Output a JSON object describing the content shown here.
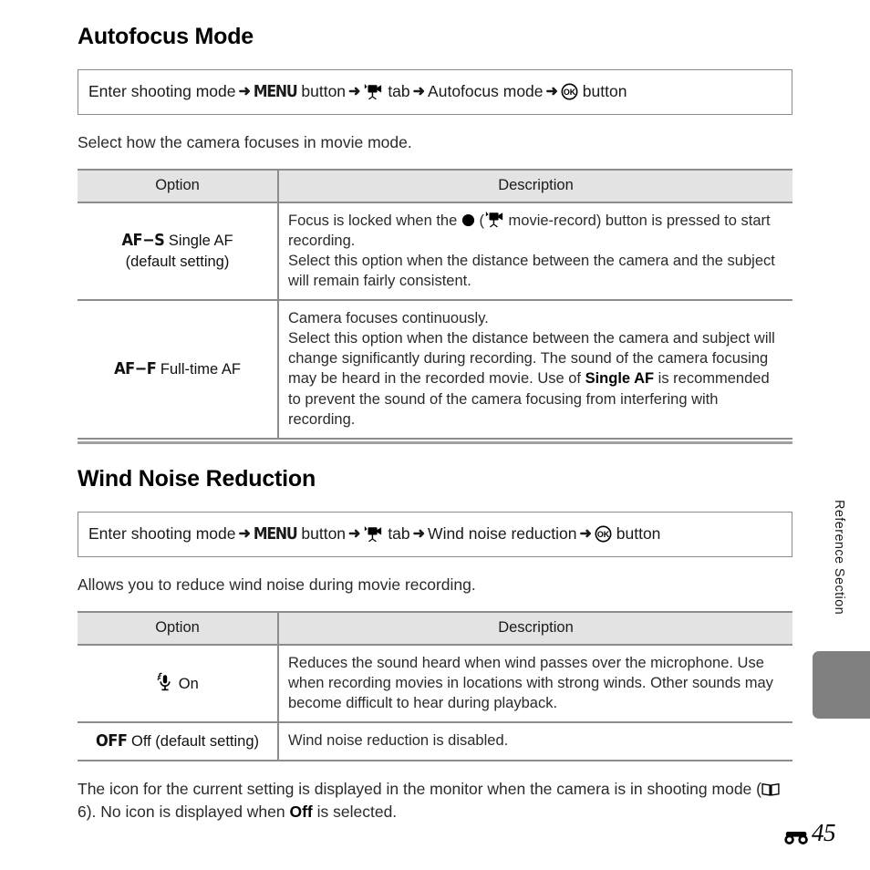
{
  "page": {
    "number_label": "45",
    "number_icon": "reference-section-e-glyph",
    "side_tab_label": "Reference Section"
  },
  "sections": [
    {
      "title": "Autofocus Mode",
      "path": {
        "step1": "Enter shooting mode",
        "menu_glyph": "MENU",
        "step2": "button",
        "tab_icon": "movie-tab-icon",
        "step3": "tab",
        "step4": "Autofocus mode",
        "ok_icon": "ok-button-icon",
        "step5": "button",
        "arrow": "➜"
      },
      "lead": "Select how the camera focuses in movie mode.",
      "table": {
        "headers": [
          "Option",
          "Description"
        ],
        "rows": [
          {
            "code": "AF−S",
            "label": "Single AF",
            "sub": "(default setting)",
            "desc_lines": [
              "Focus is locked when the ● (▶ movie-record) button is pressed to start recording.",
              "Select this option when the distance between the camera and the subject will remain fairly consistent."
            ]
          },
          {
            "code": "AF−F",
            "label": "Full-time AF",
            "sub": "",
            "desc_lines": [
              "Camera focuses continuously.",
              "Select this option when the distance between the camera and subject will change significantly during recording. The sound of the camera focusing may be heard in the recorded movie. Use of Single AF is recommended to prevent the sound of the camera focusing from interfering with recording."
            ],
            "desc_bold": "Single AF"
          }
        ]
      }
    },
    {
      "title": "Wind Noise Reduction",
      "path": {
        "step1": "Enter shooting mode",
        "menu_glyph": "MENU",
        "step2": "button",
        "tab_icon": "movie-tab-icon",
        "step3": "tab",
        "step4": "Wind noise reduction",
        "ok_icon": "ok-button-icon",
        "step5": "button",
        "arrow": "➜"
      },
      "lead": "Allows you to reduce wind noise during movie recording.",
      "table": {
        "headers": [
          "Option",
          "Description"
        ],
        "rows": [
          {
            "icon": "wind-microphone-icon",
            "label": "On",
            "desc": "Reduces the sound heard when wind passes over the microphone. Use when recording movies in locations with strong winds. Other sounds may become difficult to hear during playback."
          },
          {
            "code": "OFF",
            "label": "Off (default setting)",
            "desc": "Wind noise reduction is disabled."
          }
        ]
      }
    }
  ],
  "footer": {
    "text_before": "The icon for the current setting is displayed in the monitor when the camera is in shooting mode (",
    "book_icon": "open-book-icon",
    "page_ref": " 6). No icon is displayed when ",
    "bold_word": "Off",
    "text_after": " is selected."
  },
  "colors": {
    "header_fill": "#e3e3e3",
    "rule": "#8c8c8c",
    "side_tab": "#808080",
    "text": "#1a1a1a"
  }
}
